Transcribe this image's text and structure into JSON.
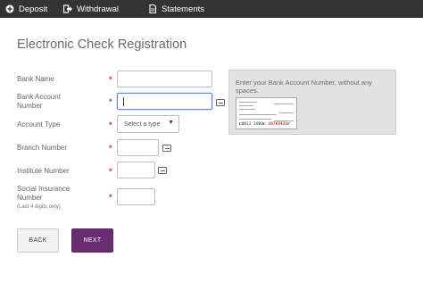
{
  "nav": {
    "tabs": [
      {
        "label": "Deposit",
        "icon": "plus-circle-icon"
      },
      {
        "label": "Withdrawal",
        "icon": "sign-out-icon"
      },
      {
        "label": "Statements",
        "icon": "file-icon"
      }
    ]
  },
  "page": {
    "title": "Electronic Check Registration"
  },
  "form": {
    "required_marker": "*",
    "bank_name": {
      "label": "Bank Name",
      "value": ""
    },
    "bank_account_number": {
      "label": "Bank Account Number",
      "value": ""
    },
    "account_type": {
      "label": "Account Type",
      "selected": "Select a type"
    },
    "branch_number": {
      "label": "Branch Number",
      "value": ""
    },
    "institute_number": {
      "label": "Institute Number",
      "value": ""
    },
    "social_insurance_number": {
      "label": "Social Insurance Number",
      "hint": "(Last 4 digits only)",
      "value": ""
    }
  },
  "help": {
    "text": "Enter your Bank Account Number, without any spaces.",
    "micr_prefix": "⑆0012 1000⑆",
    "micr_highlight": "38765432",
    "micr_suffix": "⑈"
  },
  "buttons": {
    "back": "BACK",
    "next": "NEXT"
  },
  "colors": {
    "topbar": "#333333",
    "primary": "#6a2c70",
    "required": "#c0392b",
    "focus": "#5b8dd9"
  }
}
